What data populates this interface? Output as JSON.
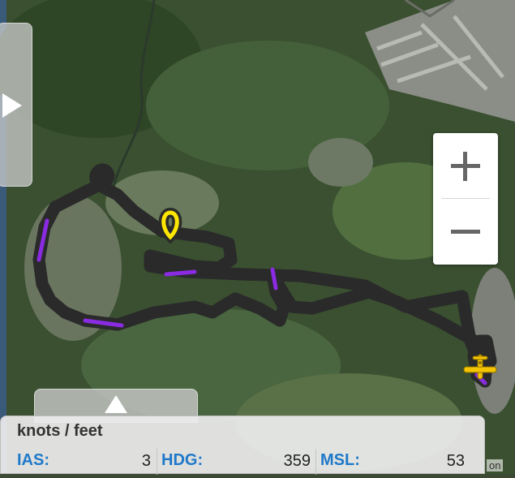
{
  "map": {
    "type": "satellite",
    "track_colors": {
      "outline": "#2a2a2a",
      "main": "#87cdf2",
      "alt": "#8a2be2",
      "start": "#ffe600"
    },
    "aircraft_icon": "airplane-icon",
    "aircraft_color": "#f5c400"
  },
  "zoom": {
    "in_icon": "plus-icon",
    "out_icon": "minus-icon"
  },
  "side_toggle": {
    "icon": "chevron-right-icon"
  },
  "bottom_tab": {
    "icon": "chevron-up-icon"
  },
  "panel": {
    "title": "knots / feet",
    "fields": [
      {
        "label": "IAS:",
        "value": "3"
      },
      {
        "label": "HDG:",
        "value": "359"
      },
      {
        "label": "MSL:",
        "value": "53"
      }
    ]
  },
  "attribution": "on"
}
